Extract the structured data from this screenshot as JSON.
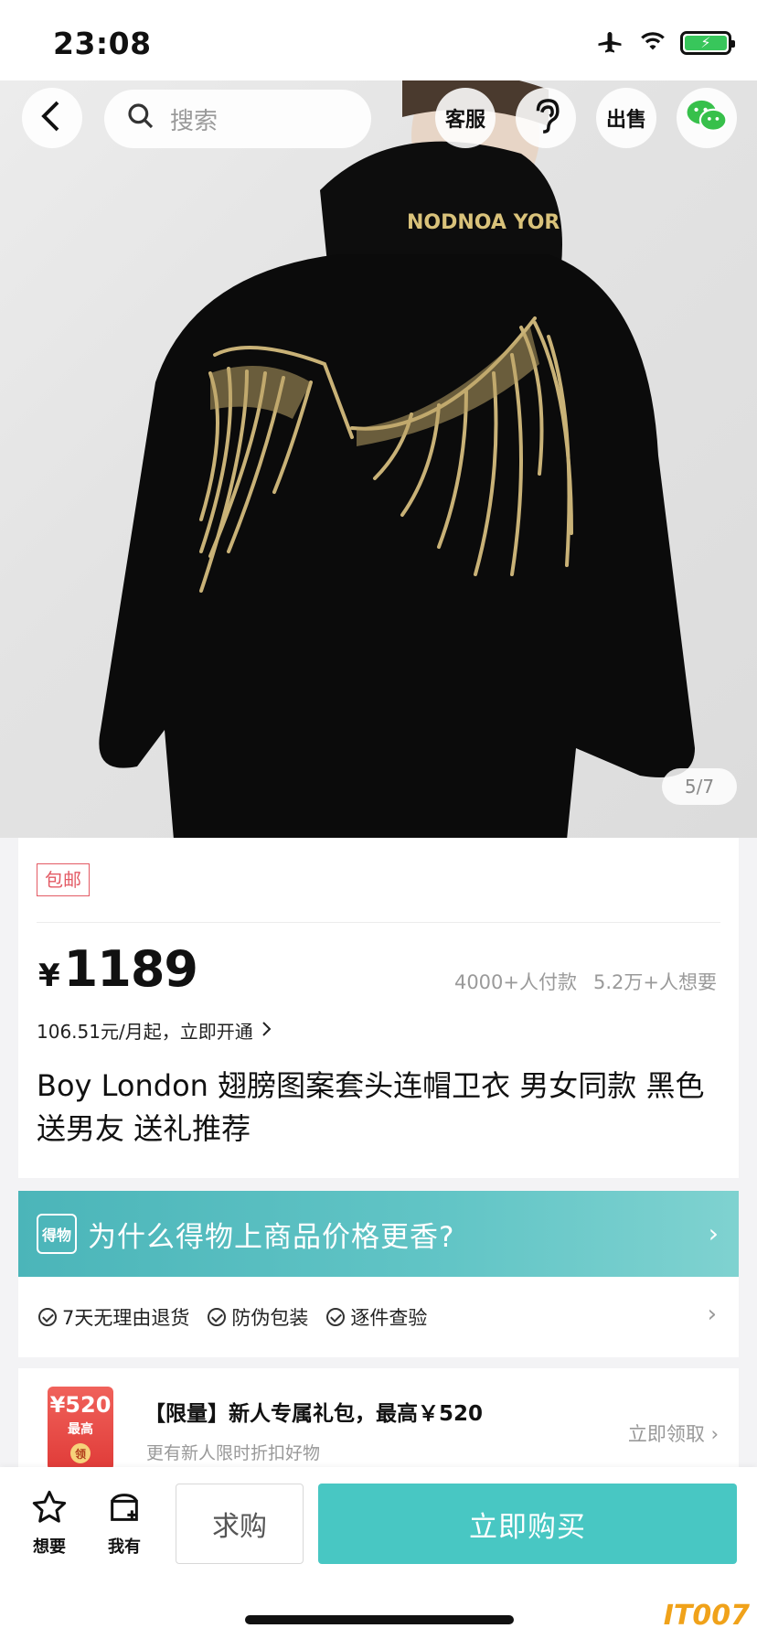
{
  "status_bar": {
    "time": "23:08",
    "icons": [
      "airplane-icon",
      "wifi-icon",
      "battery-charging-icon"
    ],
    "battery_color": "#38c65b"
  },
  "nav": {
    "search_placeholder": "搜索",
    "customer_service_label": "客服",
    "sell_label": "出售",
    "icons": [
      "back-icon",
      "search-icon",
      "customer-service-icon",
      "ear-icon",
      "sell-icon",
      "wechat-icon"
    ]
  },
  "image": {
    "page_indicator": "5/7",
    "hood_text": "NODNOA YOR"
  },
  "info": {
    "free_shipping_tag": "包邮",
    "price_symbol": "¥",
    "price": "1189",
    "paid_count": "4000+人付款",
    "wants_count": "5.2万+人想要",
    "installment_text": "106.51元/月起，立即开通",
    "title": "Boy London 翅膀图案套头连帽卫衣 男女同款 黑色 送男友 送礼推荐"
  },
  "why": {
    "logo_text": "得物",
    "text": "为什么得物上商品价格更香?"
  },
  "guarantees": [
    {
      "label": "7天无理由退货"
    },
    {
      "label": "防伪包装"
    },
    {
      "label": "逐件查验"
    }
  ],
  "coupon": {
    "image_amount": "¥520",
    "image_sub": "最高",
    "image_badge": "领",
    "title": "【限量】新人专属礼包，最高￥520",
    "subtitle": "更有新人限时折扣好物",
    "action": "立即领取"
  },
  "bottom": {
    "want_label": "想要",
    "have_label": "我有",
    "ask_label": "求购",
    "buy_label": "立即购买"
  },
  "colors": {
    "accent_teal": "#48c7c3",
    "tag_red": "#e35a64",
    "banner_start": "#4bb5b9",
    "banner_end": "#7fd2d0"
  },
  "watermark": "IT007"
}
